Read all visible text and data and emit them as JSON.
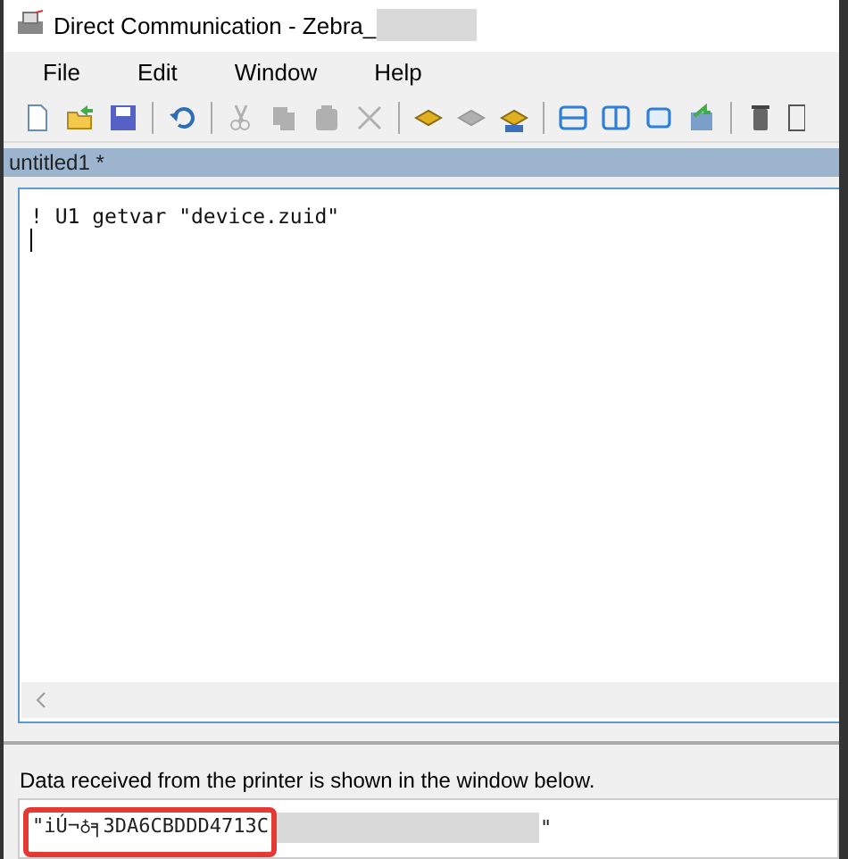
{
  "window": {
    "title": "Direct Communication - Zebra_",
    "title_redacted": true
  },
  "menu": [
    "File",
    "Edit",
    "Window",
    "Help"
  ],
  "toolbar": [
    {
      "kind": "new"
    },
    {
      "kind": "open"
    },
    {
      "kind": "save"
    },
    {
      "kind": "sep"
    },
    {
      "kind": "undo"
    },
    {
      "kind": "sep"
    },
    {
      "kind": "cut",
      "disabled": true
    },
    {
      "kind": "copy",
      "disabled": true
    },
    {
      "kind": "paste",
      "disabled": true
    },
    {
      "kind": "delete",
      "disabled": true
    },
    {
      "kind": "sep"
    },
    {
      "kind": "send",
      "disabled": false
    },
    {
      "kind": "receive",
      "disabled": true
    },
    {
      "kind": "sendreceive",
      "disabled": false
    },
    {
      "kind": "sep"
    },
    {
      "kind": "splith"
    },
    {
      "kind": "splitv"
    },
    {
      "kind": "single"
    },
    {
      "kind": "export"
    },
    {
      "kind": "sep"
    },
    {
      "kind": "trash"
    },
    {
      "kind": "panel"
    }
  ],
  "document_tab": "untitled1 *",
  "editor_lines": [
    "! U1 getvar \"device.zuid\""
  ],
  "output_label": "Data received from the printer is shown in the window below.",
  "output": {
    "value": "\"iÚ¬♁╕3DA6CBDDD4713C",
    "end": "\"",
    "redacted": true,
    "highlighted": true
  }
}
